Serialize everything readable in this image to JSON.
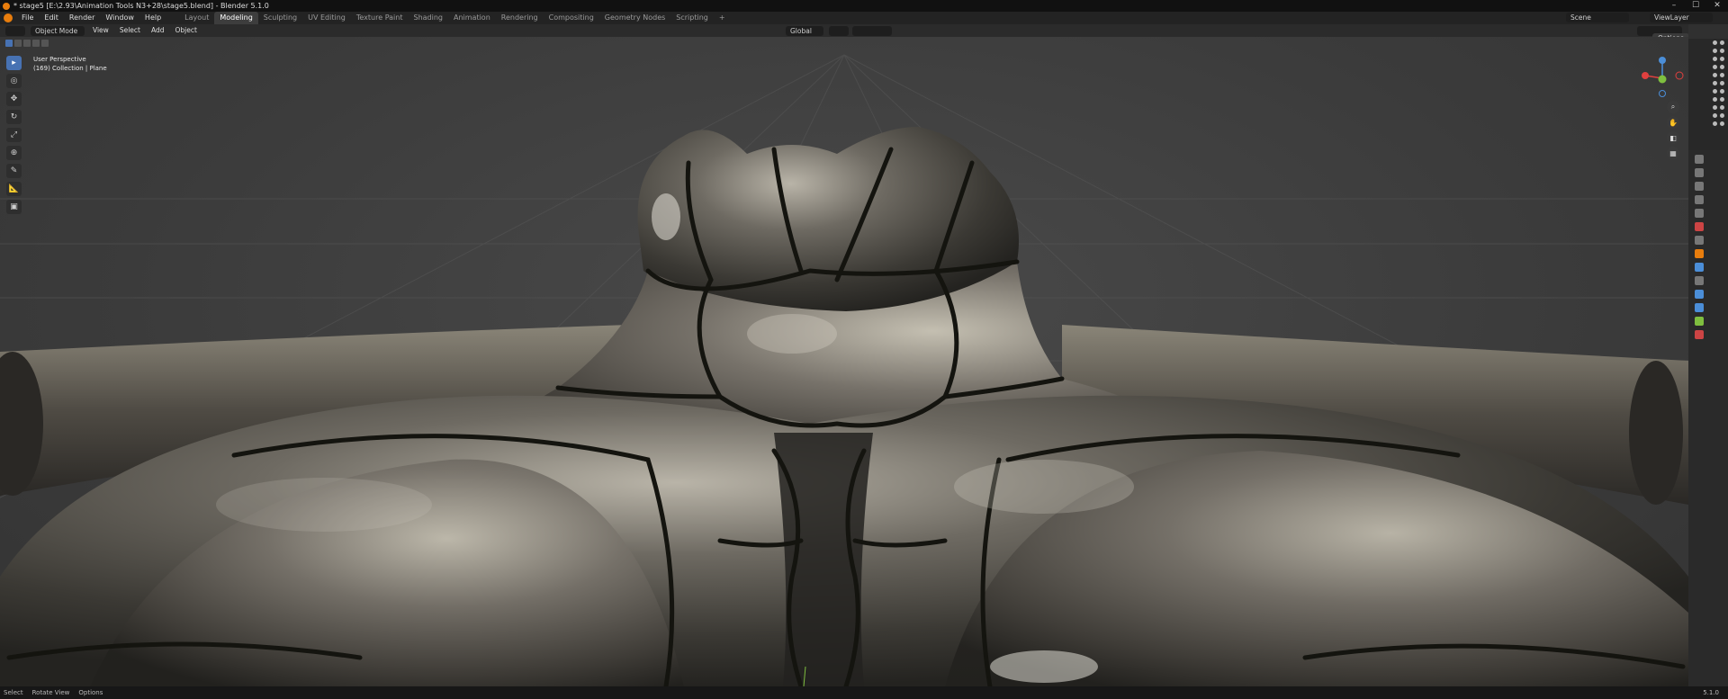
{
  "window": {
    "title": "* stage5 [E:\\2.93\\Animation Tools N3+28\\stage5.blend] - Blender 5.1.0",
    "controls": [
      "–",
      "☐",
      "✕"
    ]
  },
  "menu": [
    "File",
    "Edit",
    "Render",
    "Window",
    "Help"
  ],
  "workspaces": [
    {
      "label": "Layout",
      "active": false
    },
    {
      "label": "Modeling",
      "active": true
    },
    {
      "label": "Sculpting",
      "active": false
    },
    {
      "label": "UV Editing",
      "active": false
    },
    {
      "label": "Texture Paint",
      "active": false
    },
    {
      "label": "Shading",
      "active": false
    },
    {
      "label": "Animation",
      "active": false
    },
    {
      "label": "Rendering",
      "active": false
    },
    {
      "label": "Compositing",
      "active": false
    },
    {
      "label": "Geometry Nodes",
      "active": false
    },
    {
      "label": "Scripting",
      "active": false
    }
  ],
  "add_workspace": "+",
  "scene": {
    "label": "Scene",
    "view_layer": "ViewLayer"
  },
  "viewport_header": {
    "mode": "Object Mode",
    "menus": [
      "View",
      "Select",
      "Add",
      "Object"
    ],
    "orientation": "Global",
    "options": "Options"
  },
  "overlay": {
    "line1": "User Perspective",
    "line2": "(169) Collection | Plane"
  },
  "tools": [
    "select-box",
    "cursor",
    "move",
    "rotate",
    "scale",
    "transform",
    "annotate",
    "measure",
    "add-cube"
  ],
  "gizmo": {
    "z": "Z",
    "y": "Y",
    "x": "X"
  },
  "status": {
    "select": "Select",
    "rotate": "Rotate View",
    "options": "Options",
    "version": "5.1.0"
  },
  "colors": {
    "accent": "#4772b3",
    "blender_orange": "#e87d0d",
    "axis_x": "#e0403f",
    "axis_y": "#7fbf3f",
    "axis_z": "#4b8ed8"
  }
}
